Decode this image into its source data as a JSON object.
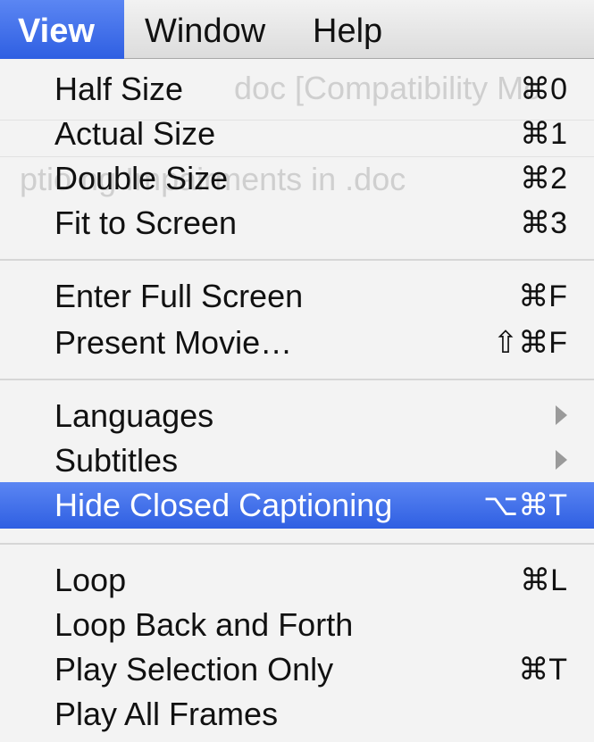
{
  "menubar": {
    "items": [
      {
        "label": "View",
        "active": true
      },
      {
        "label": "Window"
      },
      {
        "label": "Help"
      }
    ]
  },
  "background_text": {
    "line1": "doc [Compatibility Mo",
    "line2": "ptio                ng Impairments in .doc"
  },
  "menu": {
    "groups": [
      [
        {
          "label": "Half Size",
          "shortcut": "⌘0"
        },
        {
          "label": "Actual Size",
          "shortcut": "⌘1"
        },
        {
          "label": "Double Size",
          "shortcut": "⌘2"
        },
        {
          "label": "Fit to Screen",
          "shortcut": "⌘3"
        }
      ],
      [
        {
          "label": "Enter Full Screen",
          "shortcut": "⌘F"
        },
        {
          "label": "Present Movie…",
          "shortcut": "⇧⌘F"
        }
      ],
      [
        {
          "label": "Languages",
          "submenu": true
        },
        {
          "label": "Subtitles",
          "submenu": true
        },
        {
          "label": "Hide Closed Captioning",
          "shortcut": "⌥⌘T",
          "highlighted": true
        }
      ],
      [
        {
          "label": "Loop",
          "shortcut": "⌘L"
        },
        {
          "label": "Loop Back and Forth",
          "shortcut": ""
        },
        {
          "label": "Play Selection Only",
          "shortcut": "⌘T"
        },
        {
          "label": "Play All Frames",
          "shortcut": ""
        }
      ]
    ]
  },
  "colors": {
    "highlight": "#3a68e8",
    "menu_bg": "#f3f3f3",
    "separator": "#d6d6d6"
  }
}
